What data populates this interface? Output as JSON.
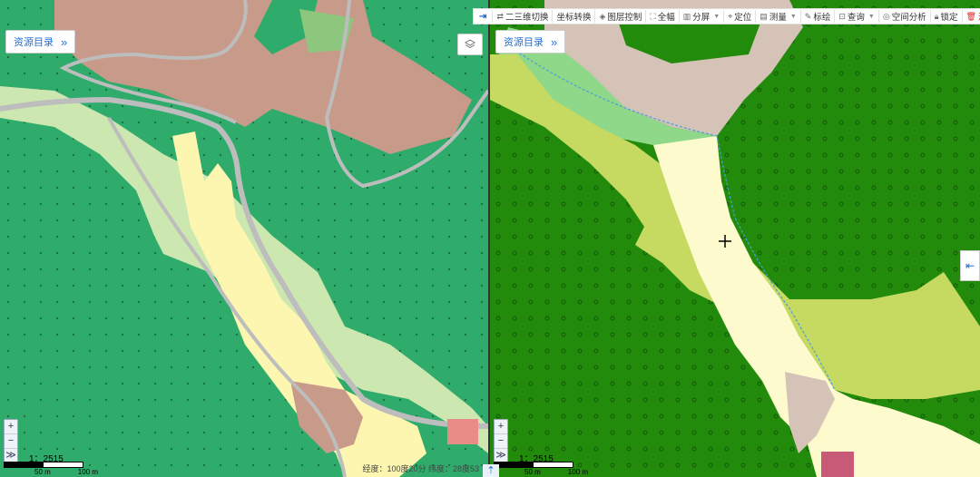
{
  "left_panel": {
    "catalog_label": "资源目录",
    "catalog_chevron": "»",
    "layers_icon": "layers-icon",
    "scale": "1：2515",
    "scale_labels": [
      "50 m",
      "100 m"
    ],
    "coordinates": "经度：100度20分  纬度：28度53"
  },
  "right_panel": {
    "catalog_label": "资源目录",
    "catalog_chevron": "»",
    "scale": "1：2515",
    "scale_labels": [
      "50 m",
      "100 m"
    ]
  },
  "toolbar": {
    "collapse_icon": "⇥",
    "items": [
      {
        "label": "二三维切换",
        "icon": "switch-icon"
      },
      {
        "label": "坐标转换",
        "icon": "coordinate-icon"
      },
      {
        "label": "图层控制",
        "icon": "layer-icon"
      },
      {
        "label": "全幅",
        "icon": "fullscreen-icon"
      },
      {
        "label": "分屏",
        "icon": "split-icon"
      },
      {
        "label": "定位",
        "icon": "locate-icon"
      },
      {
        "label": "测量",
        "icon": "measure-icon"
      },
      {
        "label": "标绘",
        "icon": "plot-icon"
      },
      {
        "label": "查询",
        "icon": "query-icon"
      },
      {
        "label": "空间分析",
        "icon": "analysis-icon"
      },
      {
        "label": "锁定",
        "icon": "lock-icon"
      },
      {
        "label": "清除",
        "icon": "clear-icon"
      }
    ]
  },
  "zoom": {
    "in": "+",
    "out": "−",
    "extent": "≫"
  },
  "side_tab_icon": "⇤",
  "bottom_arrow": "⇡",
  "colors": {
    "left_forest": "#2fab6b",
    "left_bare": "#c79a8a",
    "left_grass": "#cde7b0",
    "left_sand": "#fcf6b0",
    "right_forest": "#228b0c",
    "right_bare": "#d5c3b7",
    "right_grass": "#c6da62",
    "right_sand": "#fdfbce",
    "right_meadow": "#8fd88a"
  }
}
